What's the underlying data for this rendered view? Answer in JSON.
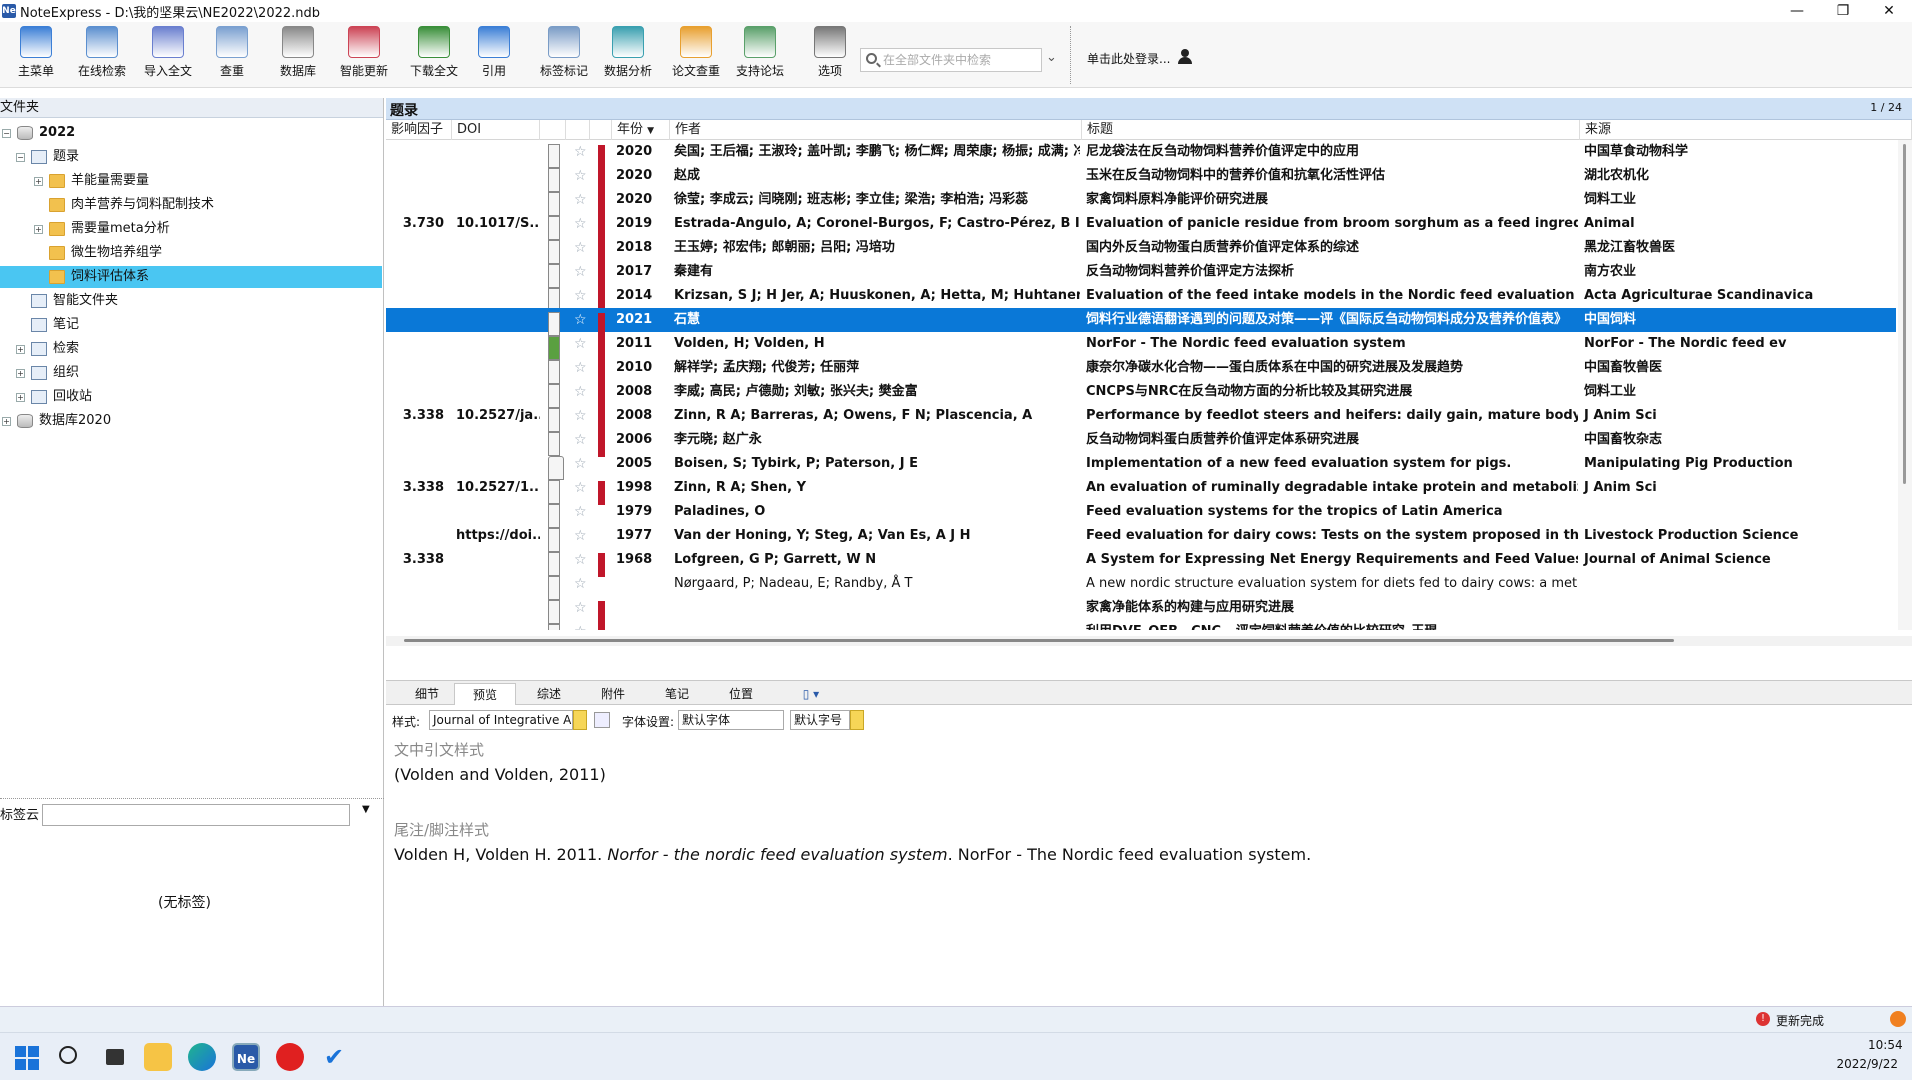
{
  "window": {
    "title": "NoteExpress - D:\\我的坚果云\\NE2022\\2022.ndb",
    "app_icon": "Ne",
    "minimize": "—",
    "maximize": "❐",
    "close": "✕"
  },
  "toolbar": {
    "items": [
      {
        "label": "主菜单",
        "icon": "main-menu-icon"
      },
      {
        "label": "在线检索",
        "icon": "online-search-icon"
      },
      {
        "label": "导入全文",
        "icon": "import-fulltext-icon"
      },
      {
        "label": "查重",
        "icon": "dedupe-icon"
      },
      {
        "label": "数据库",
        "icon": "database-icon"
      },
      {
        "label": "智能更新",
        "icon": "smart-update-icon"
      },
      {
        "label": "下载全文",
        "icon": "download-fulltext-icon"
      },
      {
        "label": "引用",
        "icon": "cite-icon"
      },
      {
        "label": "标签标记",
        "icon": "tag-icon"
      },
      {
        "label": "数据分析",
        "icon": "analysis-icon"
      },
      {
        "label": "论文查重",
        "icon": "paper-dedupe-icon"
      },
      {
        "label": "支持论坛",
        "icon": "forum-icon"
      },
      {
        "label": "选项",
        "icon": "options-icon"
      }
    ],
    "search_placeholder": "在全部文件夹中检索",
    "login_text": "单击此处登录..."
  },
  "left": {
    "header": "文件夹",
    "tree": [
      {
        "label": "2022",
        "level": 0,
        "expander": "⊟",
        "icon": "database-icon",
        "bold": true
      },
      {
        "label": "题录",
        "level": 1,
        "expander": "⊟",
        "icon": "list-icon"
      },
      {
        "label": "羊能量需要量",
        "level": 2,
        "expander": "⊞",
        "icon": "folder-icon"
      },
      {
        "label": "肉羊营养与饲料配制技术",
        "level": 2,
        "expander": "",
        "icon": "folder-icon"
      },
      {
        "label": "需要量meta分析",
        "level": 2,
        "expander": "⊞",
        "icon": "folder-icon"
      },
      {
        "label": "微生物培养组学",
        "level": 2,
        "expander": "",
        "icon": "folder-icon"
      },
      {
        "label": "饲料评估体系",
        "level": 2,
        "expander": "",
        "icon": "folder-icon",
        "selected": true
      },
      {
        "label": "智能文件夹",
        "level": 1,
        "expander": "",
        "icon": "smart-folder-icon"
      },
      {
        "label": "笔记",
        "level": 1,
        "expander": "",
        "icon": "notes-icon"
      },
      {
        "label": "检索",
        "level": 1,
        "expander": "⊞",
        "icon": "search-icon"
      },
      {
        "label": "组织",
        "level": 1,
        "expander": "⊞",
        "icon": "organize-icon"
      },
      {
        "label": "回收站",
        "level": 1,
        "expander": "⊞",
        "icon": "recycle-icon"
      },
      {
        "label": "数据库2020",
        "level": 0,
        "expander": "⊞",
        "icon": "database-icon"
      }
    ],
    "tag_cloud_label": "标签云",
    "no_tags": "(无标签)"
  },
  "list": {
    "title": "题录",
    "page": "1 / 24",
    "columns": {
      "impact": "影响因子",
      "doi": "DOI",
      "year": "年份",
      "author": "作者",
      "title": "标题",
      "source": "来源"
    },
    "rows": [
      {
        "impact": "",
        "doi": "",
        "year": "2020",
        "author": "矣国; 王后福; 王淑玲; 盖叶凯; 李鹏飞; 杨仁辉; 周荣康; 杨振; 成满; 冷静",
        "title": "尼龙袋法在反刍动物饲料营养价值评定中的应用",
        "source": "中国草食动物科学",
        "flag": true,
        "bold": true
      },
      {
        "impact": "",
        "doi": "",
        "year": "2020",
        "author": "赵成",
        "title": "玉米在反刍动物饲料中的营养价值和抗氧化活性评估",
        "source": "湖北农机化",
        "flag": true,
        "bold": true
      },
      {
        "impact": "",
        "doi": "",
        "year": "2020",
        "author": "徐莹; 李成云; 闫晓刚; 班志彬; 李立佳; 梁浩; 李柏浩; 冯彩蕊",
        "title": "家禽饲料原料净能评价研究进展",
        "source": "饲料工业",
        "flag": true,
        "bold": true
      },
      {
        "impact": "3.730",
        "doi": "10.1017/S...",
        "year": "2019",
        "author": "Estrada-Angulo, A; Coronel-Burgos, F; Castro-Pérez, B I; Barreras, A; Zinn",
        "title": "Evaluation of panicle residue from broom sorghum as a feed ingredient in",
        "source": "Animal",
        "flag": true,
        "bold": true
      },
      {
        "impact": "",
        "doi": "",
        "year": "2018",
        "author": "王玉婷; 祁宏伟; 郎朝丽; 吕阳; 冯培功",
        "title": "国内外反刍动物蛋白质营养价值评定体系的综述",
        "source": "黑龙江畜牧兽医",
        "flag": true,
        "bold": true
      },
      {
        "impact": "",
        "doi": "",
        "year": "2017",
        "author": "秦建有",
        "title": "反刍动物饲料营养价值评定方法探析",
        "source": "南方农业",
        "flag": true,
        "bold": true
      },
      {
        "impact": "",
        "doi": "",
        "year": "2014",
        "author": "Krizsan, S J; H Jer, A; Huuskonen, A; Hetta, M; Huhtanen, P",
        "title": "Evaluation of the feed intake models in the Nordic feed evaluation system",
        "source": "Acta Agriculturae Scandinavica",
        "flag": true,
        "bold": true
      },
      {
        "impact": "",
        "doi": "",
        "year": "2021",
        "author": "石慧",
        "title": "饲料行业德语翻译遇到的问题及对策——评《国际反刍动物饲料成分及营养价值表》",
        "source": "中国饲料",
        "flag": true,
        "bold": true,
        "selected": true
      },
      {
        "impact": "",
        "doi": "",
        "year": "2011",
        "author": "Volden, H; Volden, H",
        "title": "NorFor - The Nordic feed evaluation system",
        "source": "NorFor - The Nordic feed ev",
        "flag": true,
        "bold": true,
        "green": true
      },
      {
        "impact": "",
        "doi": "",
        "year": "2010",
        "author": "解祥学; 孟庆翔; 代俊芳; 任丽萍",
        "title": "康奈尔净碳水化合物——蛋白质体系在中国的研究进展及发展趋势",
        "source": "中国畜牧兽医",
        "flag": true,
        "bold": true
      },
      {
        "impact": "",
        "doi": "",
        "year": "2008",
        "author": "李威; 高民; 卢德勋; 刘敏; 张兴夫; 樊金富",
        "title": "CNCPS与NRC在反刍动物方面的分析比较及其研究进展",
        "source": "饲料工业",
        "flag": true,
        "bold": true
      },
      {
        "impact": "3.338",
        "doi": "10.2527/ja...",
        "year": "2008",
        "author": "Zinn, R A; Barreras, A; Owens, F N; Plascencia, A",
        "title": "Performance by feedlot steers and heifers: daily gain, mature body weight",
        "source": "J Anim Sci",
        "flag": true,
        "bold": true
      },
      {
        "impact": "",
        "doi": "",
        "year": "2006",
        "author": "李元晓; 赵广永",
        "title": "反刍动物饲料蛋白质营养价值评定体系研究进展",
        "source": "中国畜牧杂志",
        "flag": true,
        "bold": true
      },
      {
        "impact": "",
        "doi": "",
        "year": "2005",
        "author": "Boisen, S; Tybirk, P; Paterson, J E",
        "title": "Implementation of a new feed evaluation system for pigs.",
        "source": "Manipulating Pig Production",
        "flag": false,
        "bold": true,
        "book": true
      },
      {
        "impact": "3.338",
        "doi": "10.2527/1...",
        "year": "1998",
        "author": "Zinn, R A; Shen, Y",
        "title": "An evaluation of ruminally degradable intake protein and metabolizable a",
        "source": "J Anim Sci",
        "flag": true,
        "bold": true
      },
      {
        "impact": "",
        "doi": "",
        "year": "1979",
        "author": "Paladines, O",
        "title": "Feed evaluation systems for the tropics of Latin America",
        "source": "",
        "flag": false,
        "bold": true
      },
      {
        "impact": "",
        "doi": "https://doi...",
        "year": "1977",
        "author": "Van der Honing, Y; Steg, A; Van Es, A J H",
        "title": "Feed evaluation for dairy cows: Tests on the system proposed in the Neth",
        "source": "Livestock Production Science",
        "flag": false,
        "bold": true
      },
      {
        "impact": "3.338",
        "doi": "",
        "year": "1968",
        "author": "Lofgreen, G P; Garrett, W N",
        "title": "A System for Expressing Net Energy Requirements and Feed Values for Gr",
        "source": "Journal of Animal Science",
        "flag": true,
        "bold": true
      },
      {
        "impact": "",
        "doi": "",
        "year": "",
        "author": "Nørgaard, P; Nadeau, E; Randby, Å T",
        "title": "A new nordic structure evaluation system for diets fed to dairy cows: a meta ...",
        "source": "",
        "flag": false,
        "bold": false
      },
      {
        "impact": "",
        "doi": "",
        "year": "",
        "author": "",
        "title": "家禽净能体系的构建与应用研究进展",
        "source": "",
        "flag": true,
        "bold": true
      },
      {
        "impact": "",
        "doi": "",
        "year": "",
        "author": "",
        "title": "利用DVE_OEB、CNC...评定饲料营养价值的比较研究_王琨",
        "source": "",
        "flag": true,
        "bold": true
      }
    ]
  },
  "bottom": {
    "tabs": [
      "细节",
      "预览",
      "综述",
      "附件",
      "笔记",
      "位置"
    ],
    "active_tab": "预览",
    "style_label": "样式:",
    "style_value": "Journal of Integrative A",
    "font_label": "字体设置:",
    "font_value": "默认字体",
    "size_value": "默认字号",
    "in_text_label": "文中引文样式",
    "in_text": "(Volden and Volden, 2011)",
    "footnote_label": "尾注/脚注样式",
    "footnote_pre": "Volden H, Volden H. 2011. ",
    "footnote_italic": "Norfor - the nordic feed evaluation system",
    "footnote_post": ". NorFor - The Nordic feed evaluation system."
  },
  "status": {
    "update_text": "更新完成"
  },
  "taskbar": {
    "time": "10:54",
    "date": "2022/9/22"
  }
}
